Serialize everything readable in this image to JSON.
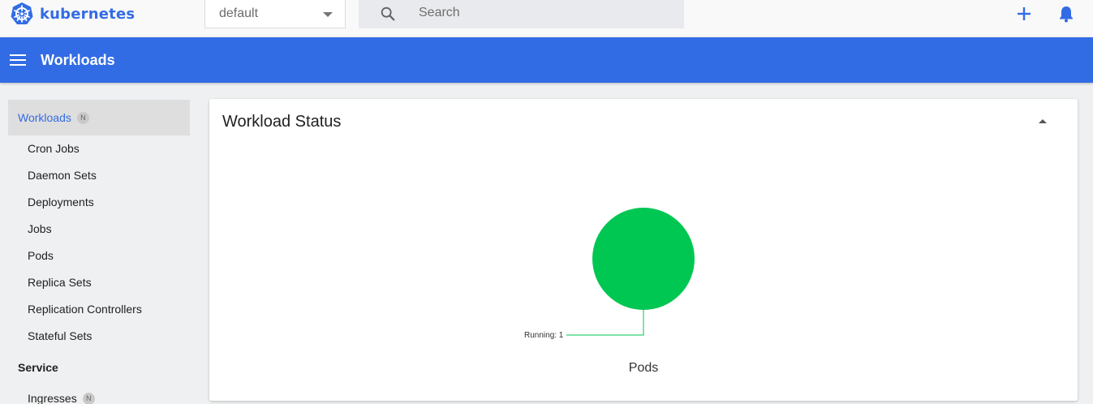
{
  "app": {
    "brand_name": "kubernetes",
    "brand_color": "#326ce5",
    "logo_icon": "kubernetes-helm-wheel-icon"
  },
  "toolbar": {
    "namespace_selected": "default",
    "search_placeholder": "Search",
    "add_icon": "plus-icon",
    "notifications_icon": "bell-icon"
  },
  "titlebar": {
    "title": "Workloads",
    "menu_icon": "hamburger-menu-icon",
    "background": "#326ce5"
  },
  "sidebar": {
    "groups": [
      {
        "label": "Workloads",
        "badge": "N",
        "active": true
      },
      {
        "label": "Service",
        "badge": "",
        "active": false
      }
    ],
    "workload_items": [
      {
        "label": "Cron Jobs"
      },
      {
        "label": "Daemon Sets"
      },
      {
        "label": "Deployments"
      },
      {
        "label": "Jobs"
      },
      {
        "label": "Pods"
      },
      {
        "label": "Replica Sets"
      },
      {
        "label": "Replication Controllers"
      },
      {
        "label": "Stateful Sets"
      }
    ],
    "service_items": [
      {
        "label": "Ingresses",
        "badge": "N"
      }
    ]
  },
  "main": {
    "card_title": "Workload Status",
    "collapse_icon": "caret-up-icon"
  },
  "chart_data": {
    "type": "pie",
    "title": "Pods",
    "categories": [
      "Running"
    ],
    "values": [
      1
    ],
    "labels": [
      "Running: 1"
    ],
    "colors": [
      "#00c752"
    ]
  }
}
